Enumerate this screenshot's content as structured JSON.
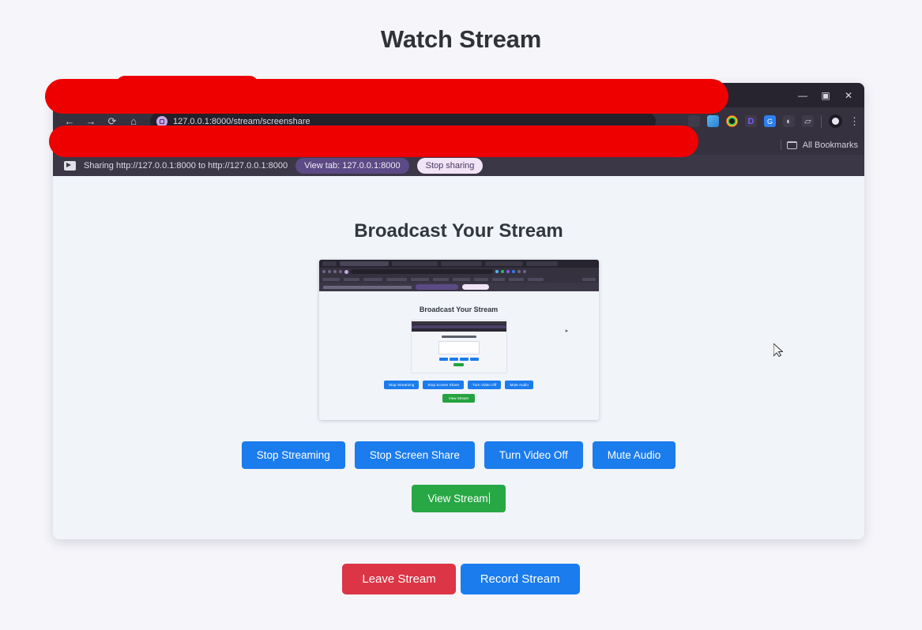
{
  "page": {
    "title": "Watch Stream",
    "background_color": "#f5f5fa"
  },
  "stream_video": {
    "browser": {
      "window_controls": {
        "minimize": "—",
        "restore": "▣",
        "close": "✕"
      },
      "nav": {
        "back_icon": "←",
        "forward_icon": "→",
        "reload_icon": "⟳",
        "home_icon": "⌂"
      },
      "omnibox": {
        "url": "127.0.0.1:8000/stream/screenshare",
        "site_badge_icon": "extension-badge-icon"
      },
      "toolbar_icons": [
        "bookmark-star-icon",
        "extension-blue-icon",
        "chrome-profile-icon",
        "extension-d-icon",
        "extension-grammarly-icon",
        "extension-dark-icon",
        "extension-outline-icon"
      ],
      "menu_icon": "⋮",
      "bookmarks_bar": {
        "label": "All Bookmarks",
        "folder_icon": "folder-icon"
      },
      "share_bar": {
        "icon": "screen-share-icon",
        "message": "Sharing http://127.0.0.1:8000 to http://127.0.0.1:8000",
        "view_tab_label": "View tab: 127.0.0.1:8000",
        "stop_sharing_label": "Stop sharing"
      }
    },
    "captured_page": {
      "heading": "Broadcast Your Stream",
      "controls": [
        {
          "label": "Stop Streaming",
          "color": "#1b7ced"
        },
        {
          "label": "Stop Screen Share",
          "color": "#1b7ced"
        },
        {
          "label": "Turn Video Off",
          "color": "#1b7ced"
        },
        {
          "label": "Mute Audio",
          "color": "#1b7ced"
        }
      ],
      "view_stream_label": "View Stream",
      "view_stream_color": "#28a745",
      "nested_preview": {
        "heading": "Broadcast Your Stream",
        "controls": [
          {
            "label": "Stop Streaming"
          },
          {
            "label": "Stop Screen Share"
          },
          {
            "label": "Turn Video Off"
          },
          {
            "label": "Mute Audio"
          }
        ],
        "view_stream_label": "View Stream",
        "cursor_icon": "mouse-cursor-icon"
      },
      "cursor_icon": "mouse-cursor-icon"
    }
  },
  "redactions": {
    "color": "#ef0000",
    "count": 3
  },
  "bottom_actions": {
    "leave_label": "Leave Stream",
    "leave_color": "#dc3545",
    "record_label": "Record Stream",
    "record_color": "#1b7ced"
  }
}
